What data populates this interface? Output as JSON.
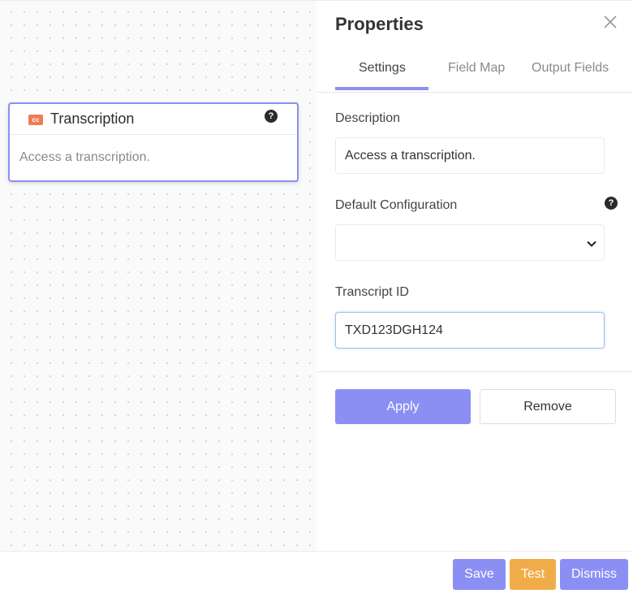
{
  "node": {
    "icon": "closed-captions-icon",
    "icon_text": "cc",
    "title": "Transcription",
    "description": "Access a transcription."
  },
  "panel": {
    "title": "Properties",
    "tabs": [
      {
        "label": "Settings",
        "active": true
      },
      {
        "label": "Field Map",
        "active": false
      },
      {
        "label": "Output Fields",
        "active": false
      }
    ],
    "description_label": "Description",
    "description_value": "Access a transcription.",
    "default_config_label": "Default Configuration",
    "default_config_value": "",
    "transcript_id_label": "Transcript ID",
    "transcript_id_value": "TXD123DGH124",
    "apply_label": "Apply",
    "remove_label": "Remove"
  },
  "footer": {
    "save_label": "Save",
    "test_label": "Test",
    "dismiss_label": "Dismiss"
  },
  "colors": {
    "accent": "#8b8ff4",
    "test": "#f1ac4a",
    "cc_badge": "#ee7d55"
  }
}
